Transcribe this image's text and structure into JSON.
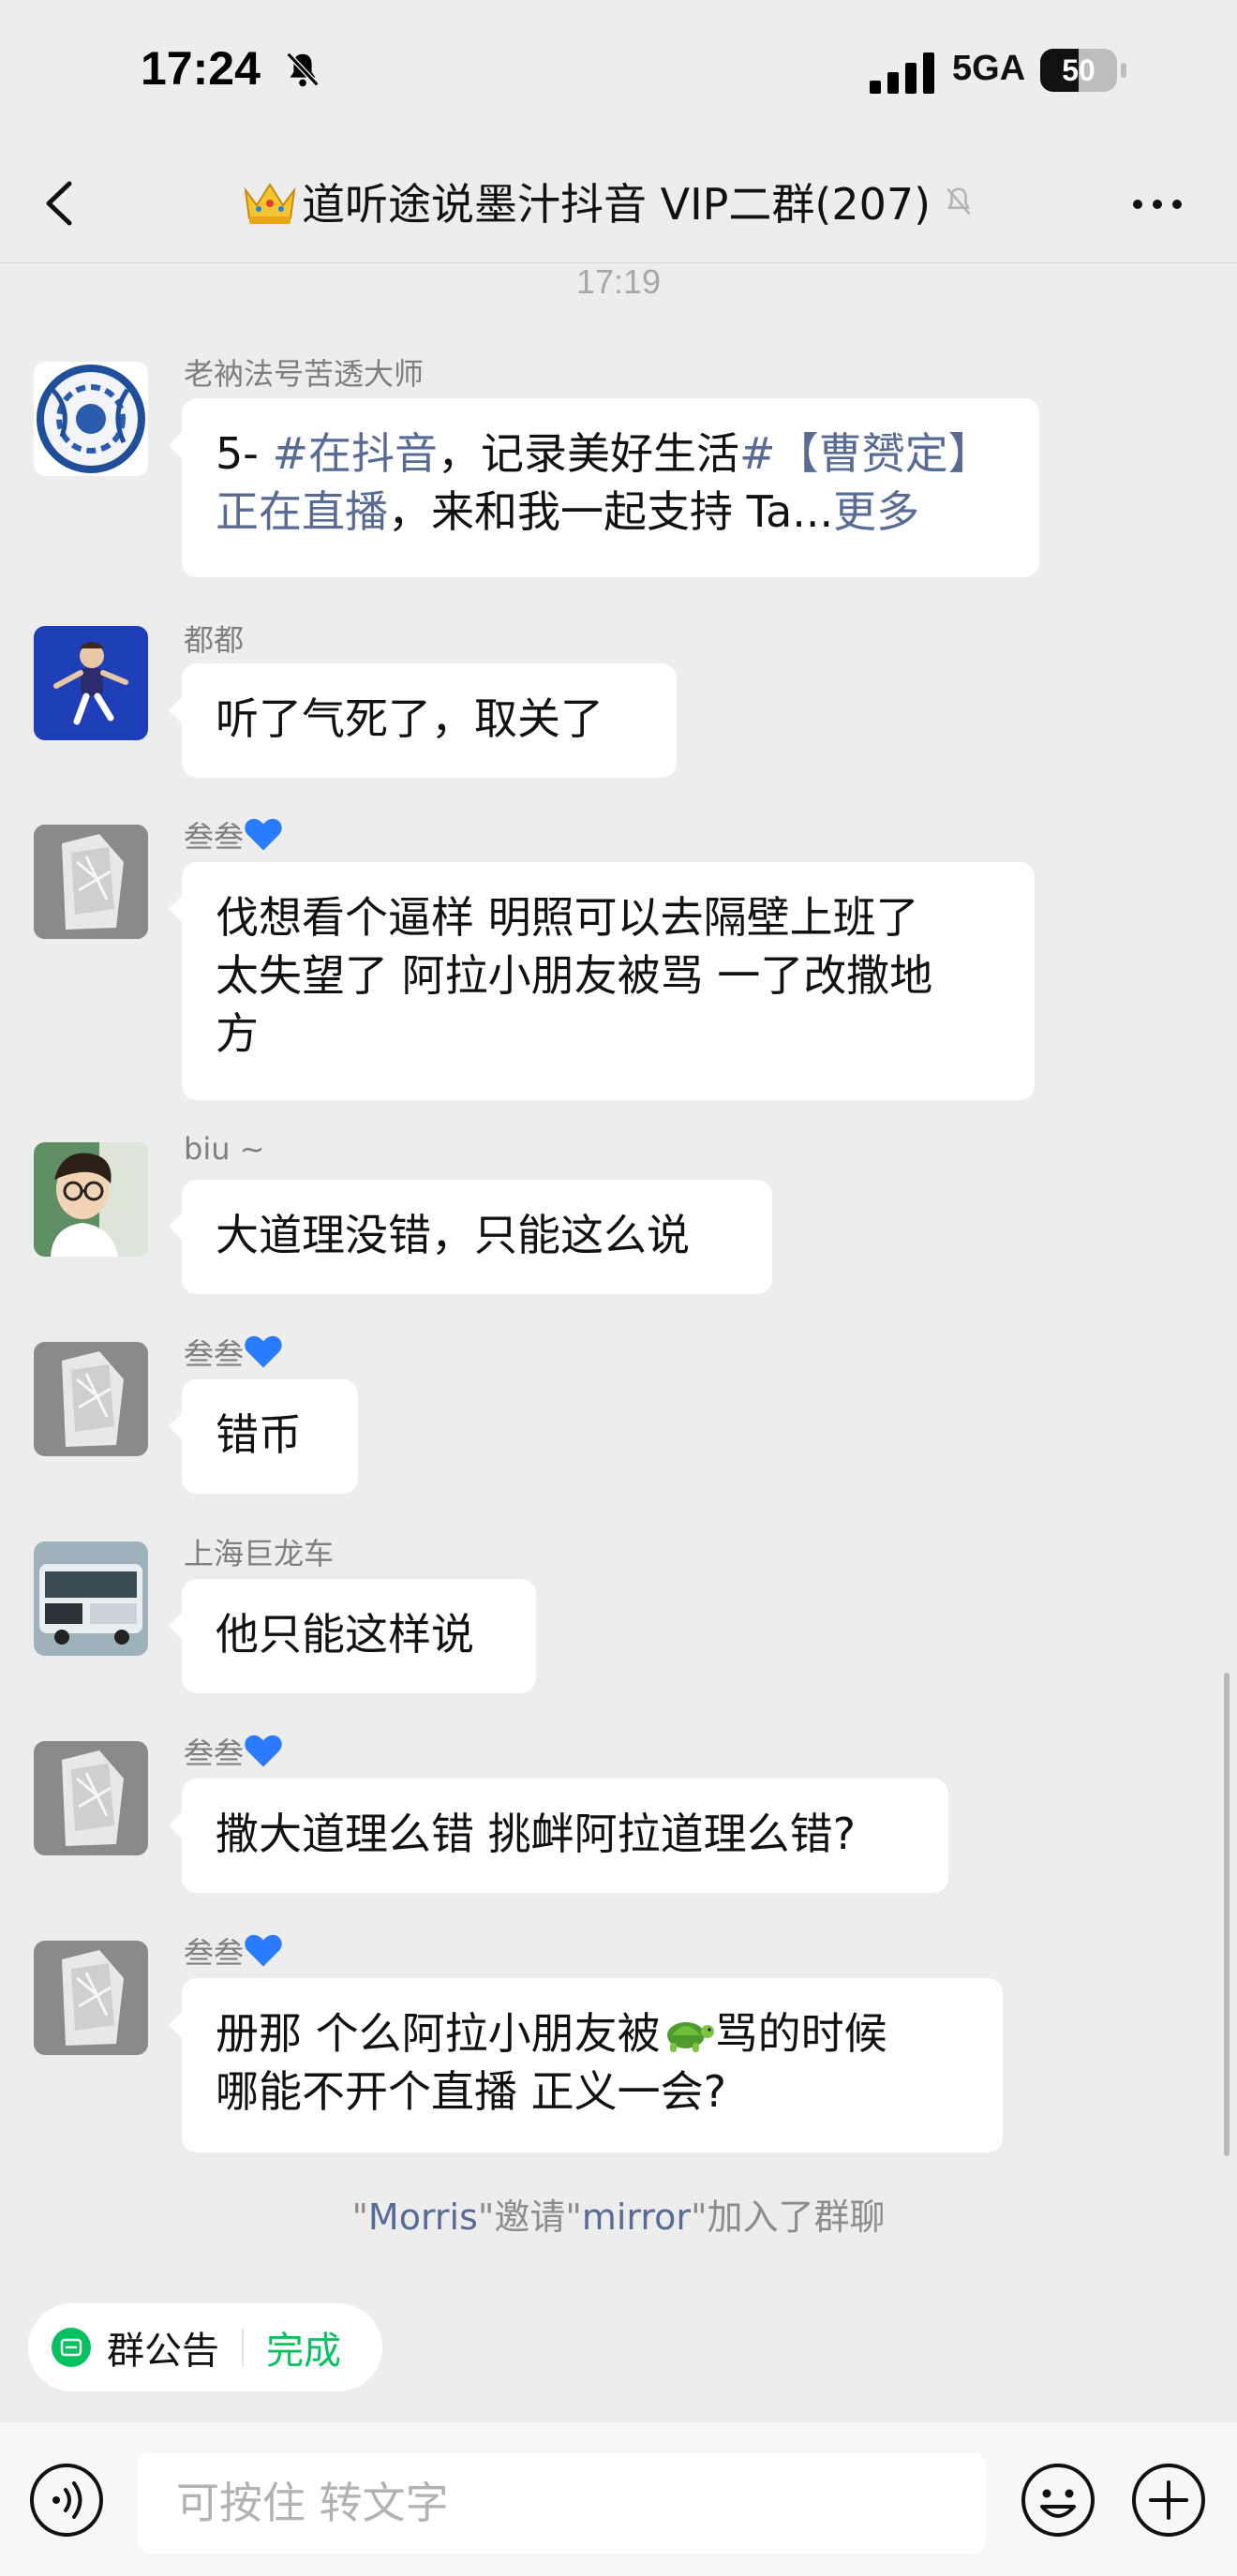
{
  "status_bar": {
    "time": "17:24",
    "network": "5GA",
    "battery": "50",
    "battery_level": 0.5
  },
  "nav": {
    "title": "道听途说墨汁抖音 VIP二群(207)"
  },
  "chat": {
    "timestamp": "17:19",
    "messages": [
      {
        "sender": "老衲法号苦透大师",
        "line1_prefix": "5- ",
        "line1_tag1": "#在抖音",
        "line1_mid": "，记录美好生活",
        "line1_tag2": "#【曹赟定】",
        "line2_tag": "正在直播",
        "line2_text": "，来和我一起支持 Ta...",
        "more": "更多"
      },
      {
        "sender": "都都",
        "text": "听了气死了，取关了"
      },
      {
        "sender": "叁叁",
        "lines": [
          "伐想看个逼样 明照可以去隔壁上班了",
          "太失望了 阿拉小朋友被骂 一了改撒地",
          "方"
        ]
      },
      {
        "sender": "biu ~",
        "text": "大道理没错，只能这么说"
      },
      {
        "sender": "叁叁",
        "text": "错币"
      },
      {
        "sender": "上海巨龙车",
        "text": "他只能这样说"
      },
      {
        "sender": "叁叁",
        "text": "撒大道理么错 挑衅阿拉道理么错?"
      },
      {
        "sender": "叁叁",
        "line1_a": "册那 个么阿拉小朋友被",
        "line1_b": "骂的时候",
        "line2": "哪能不开个直播 正义一会?"
      }
    ],
    "system_note": {
      "q1": "\"",
      "inviter": "Morris",
      "q2": "\"邀请\"",
      "invitee": "mirror",
      "q3": "\"加入了群聊"
    }
  },
  "notice": {
    "label": "群公告",
    "done": "完成"
  },
  "input": {
    "placeholder": "可按住 转文字"
  },
  "colors": {
    "background": "#EDEDED",
    "link": "#576B95",
    "done_green": "#07C160",
    "heart": "#2B7BFF"
  }
}
